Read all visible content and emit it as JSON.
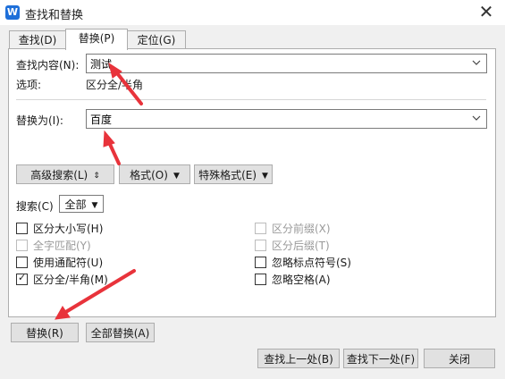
{
  "window": {
    "title": "查找和替换",
    "close_glyph": "✕",
    "app_icon_letter": "W"
  },
  "tabs": [
    {
      "label": "查找(D)"
    },
    {
      "label": "替换(P)"
    },
    {
      "label": "定位(G)"
    }
  ],
  "find": {
    "label": "查找内容(N):",
    "value": "测试"
  },
  "options": {
    "label": "选项:",
    "value": "区分全/半角"
  },
  "replace": {
    "label": "替换为(I):",
    "value": "百度"
  },
  "toolbar": {
    "advanced": "高级搜索(L)",
    "advanced_glyph": "⇕",
    "format": "格式(O)",
    "special": "特殊格式(E)"
  },
  "search": {
    "label": "搜索(C)",
    "value": "全部"
  },
  "checkboxes": {
    "match_case": "区分大小写(H)",
    "whole_word": "全字匹配(Y)",
    "wildcards": "使用通配符(U)",
    "width": "区分全/半角(M)",
    "prefix": "区分前缀(X)",
    "suffix": "区分后缀(T)",
    "ignore_punct": "忽略标点符号(S)",
    "ignore_space": "忽略空格(A)"
  },
  "checked_states": {
    "width": true
  },
  "buttons": {
    "replace": "替换(R)",
    "replace_all": "全部替换(A)",
    "find_prev": "查找上一处(B)",
    "find_next": "查找下一处(F)",
    "close": "关闭"
  },
  "colors": {
    "annotation_red": "#e8333b",
    "accent": "#1e6fd9"
  }
}
